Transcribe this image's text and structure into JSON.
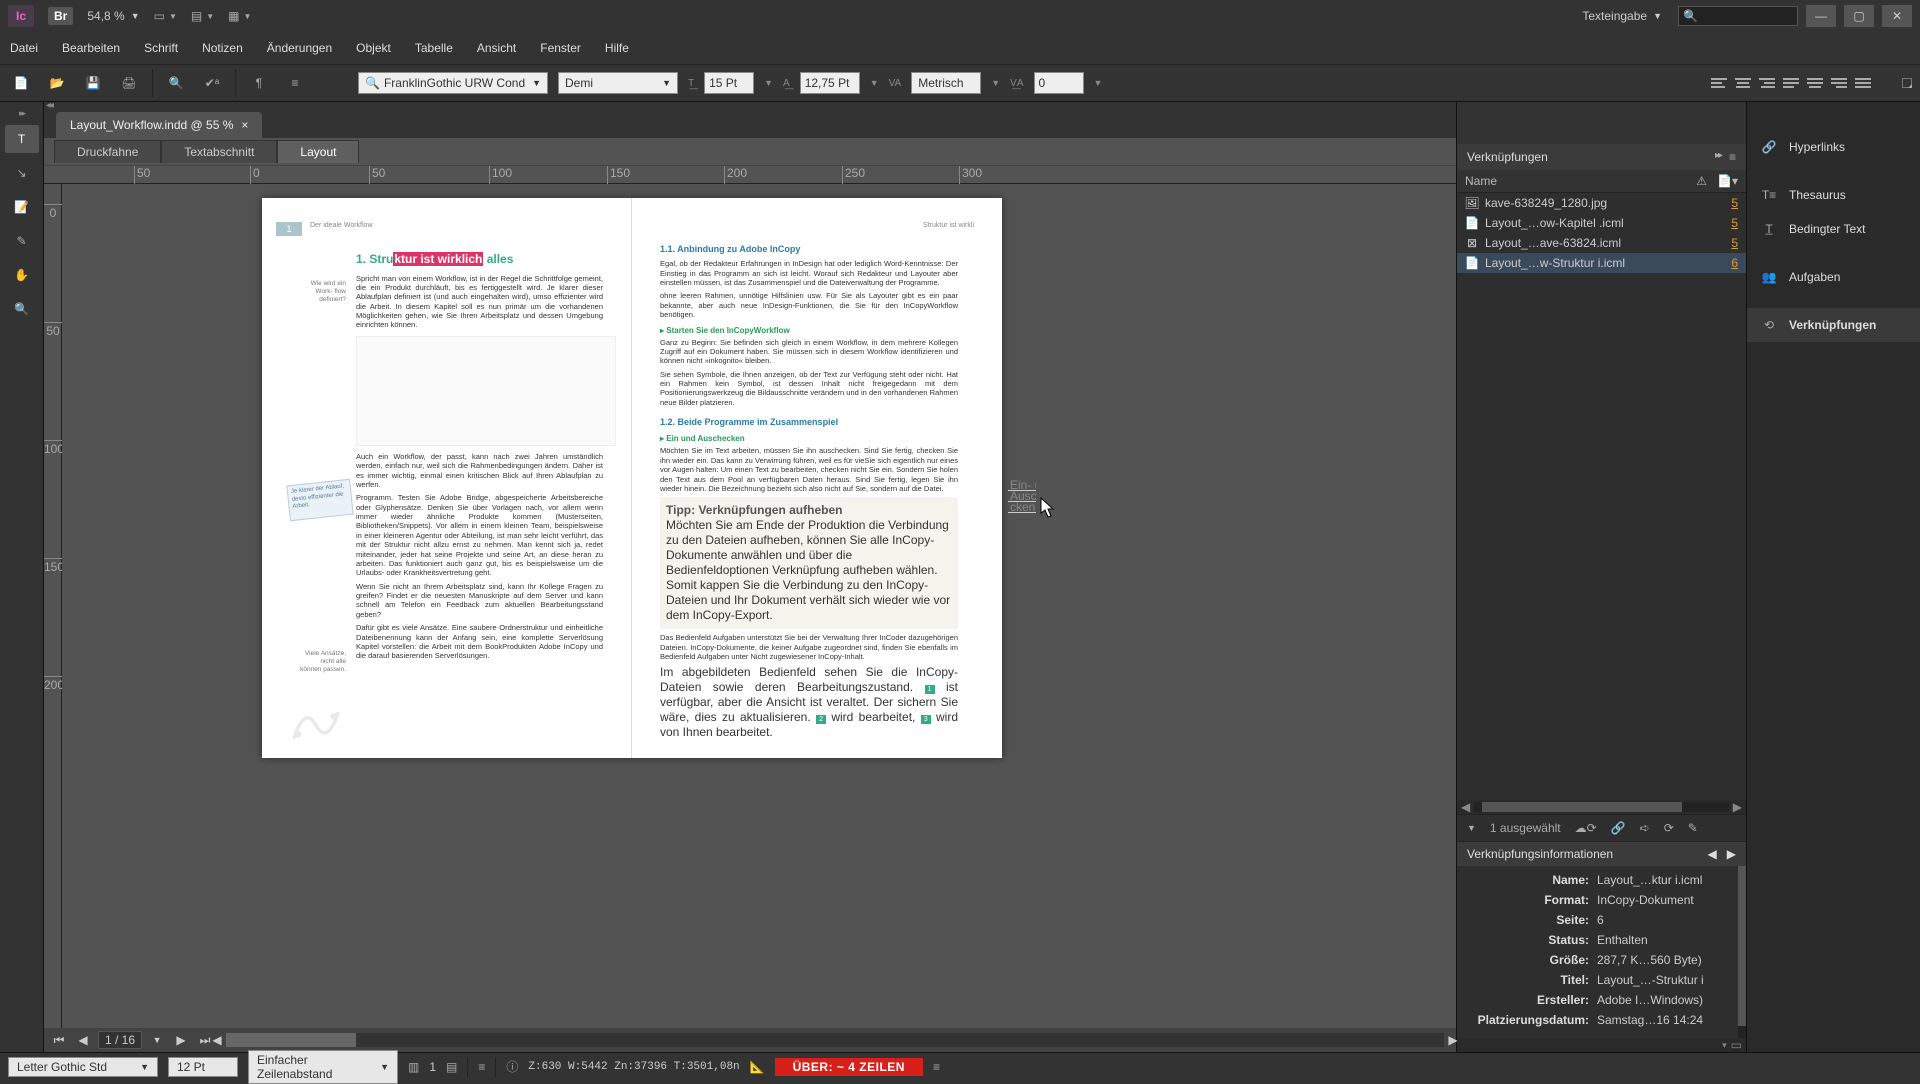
{
  "titlebar": {
    "ic": "Ic",
    "br": "Br",
    "zoom": "54,8 %",
    "workspace": "Texteingabe"
  },
  "menu": [
    "Datei",
    "Bearbeiten",
    "Schrift",
    "Notizen",
    "Änderungen",
    "Objekt",
    "Tabelle",
    "Ansicht",
    "Fenster",
    "Hilfe"
  ],
  "toolbar": {
    "font": "FranklinGothic URW Cond",
    "weight": "Demi",
    "size": "15 Pt",
    "leading": "12,75 Pt",
    "optical": "Metrisch",
    "tracking": "0"
  },
  "doc_tab": "Layout_Workflow.indd @ 55 %",
  "view_tabs": [
    "Druckfahne",
    "Textabschnitt",
    "Layout"
  ],
  "ruler_h": [
    "50",
    "0",
    "50",
    "100",
    "150",
    "200",
    "250",
    "300"
  ],
  "ruler_v": [
    "0",
    "50",
    "100",
    "150",
    "200"
  ],
  "page": {
    "num": "1",
    "run_left": "Der ideale Workflow",
    "run_right": "Struktur ist wirkli",
    "h1_pre": "1.   Stru",
    "h1_hl": "ktur ist wirklich",
    "h1_post": " alles",
    "mnote1": "Wie wird ein Work-\nflow definiert?",
    "p1": "Spricht man von einem Workflow, ist in der Regel die Schrittfolge gemeint, die ein Produkt durchläuft, bis es fertiggestellt wird. Je klarer dieser Ablaufplan definiert ist (und auch eingehalten wird), umso effizienter wird die Arbeit. In diesem Kapitel soll es nun primär um die vorhandenen Möglichkeiten gehen, wie Sie Ihren Arbeitsplatz und dessen Umgebung einrichten können.",
    "p2": "Auch ein Workflow, der passt, kann nach zwei Jahren umständlich werden, einfach nur, weil sich die Rahmenbedingungen ändern. Daher ist es immer wichtig, einmal einen kritischen Blick auf Ihren Ablaufplan zu werfen.",
    "p3": "Programm. Testen Sie Adobe Bridge, abgespeicherte Arbeitsbereiche oder Glyphensätze. Denken Sie über Vorlagen nach, vor allem wenn immer wieder ähnliche Produkte kommen (Musterseiten, Bibliotheken/Snippets). Vor allem in einem kleinen Team, beispielsweise in einer kleineren Agentur oder Abteilung, ist man sehr leicht verführt, das mit der Struktur nicht allzu ernst zu nehmen. Man kennt sich ja, redet miteinander, jeder hat seine Projekte und seine Art, an diese heran zu arbeiten. Das funktioniert auch ganz gut, bis es beispielsweise um die Urlaubs- oder Krankheitsvertretung geht.",
    "p4": "Wenn Sie nicht an Ihrem Arbeitsplatz sind, kann Ihr Kollege Fragen zu greifen? Findet er die neuesten Manuskripte auf dem Server und kann schnell am Telefon ein Feedback zum aktuellen Bearbeitungsstand geben?",
    "mnote2": "Viele Ansätze,\nnicht alle können\npassen.",
    "p5": "Dafür gibt es viele Ansätze. Eine saubere Ordnerstruktur und einheitliche Dateibenennung kann der Anfang sein, eine komplette Serverlösung Kapitel vorstellen: die Arbeit mit dem BookProdukten Adobe InCopy und die darauf basierenden Serverlösungen.",
    "sticky": "Je klarer der Ablauf,\ndesto effizienter die\nArbeit.",
    "h2a": "1.1.   Anbindung zu Adobe InCopy",
    "rp1": "Egal, ob der Redakteur Erfahrungen in InDesign hat oder lediglich Word-Kenntnisse: Der Einstieg in das Programm an sich ist leicht. Worauf sich Redakteur und Layouter aber einstellen müssen, ist das Zusammenspiel und die Dateiverwaltung der Programme.",
    "rp2": "ohne leeren Rahmen, unnötige Hilfslinien usw. Für Sie als Layouter gibt es ein paar bekannte, aber auch neue InDesign-Funktionen, die Sie für den InCopyWorkflow benötigen.",
    "h3a": "▸  Starten Sie den InCopyWorkflow",
    "rp3": "Ganz zu Beginn: Sie befinden sich gleich in einem Workflow, in dem mehrere Kollegen Zugriff auf ein Dokument haben. Sie müssen sich in diesem Workflow identifizieren und können nicht »inkognito« bleiben.",
    "rp4": "Sie sehen Symbole, die Ihnen anzeigen, ob der Text zur Verfügung steht oder nicht. Hat ein Rahmen kein Symbol, ist dessen Inhalt nicht freigegedann mit dem Positionierungswerkzeug die Bildausschnitte verändern und in den vorhandenen Rahmen neue Bilder platzieren.",
    "h2b": "1.2.   Beide Programme im Zusammenspiel",
    "h3b": "▸  Ein und Auschecken",
    "rp5": "Möchten Sie im Text arbeiten, müssen Sie ihn auschecken. Sind Sie fertig, checken Sie ihn wieder ein. Das kann zu Verwirrung führen, weil es für vieSie sich eigentlich nur eines vor Augen halten: Um einen Text zu bearbeiten, checken nicht Sie ein. Sondern Sie holen den Text aus dem Pool an verfügbaren Daten heraus. Sind Sie fertig, legen Sie ihn wieder hinein. Die Bezeichnung bezieht sich also nicht auf Sie, sondern auf die Datei.",
    "tip_t": "Tipp: Verknüpfungen aufheben",
    "tip_b": "Möchten Sie am Ende der Produktion die Verbindung zu den Dateien aufheben, können Sie alle InCopy-Dokumente anwählen und über die Bedienfeldoptionen Verknüpfung aufheben wählen. Somit kappen Sie die Verbindung zu den InCopy-Dateien und Ihr Dokument verhält sich wieder wie vor dem InCopy-Export.",
    "rp6a": "Das Bedienfeld Aufgaben unterstützt Sie bei der Verwaltung Ihrer InCoder dazugehörigen Dateien. InCopy-Dokumente, die keiner Aufgabe zugeordnet sind, finden Sie ebenfalls im Bedienfeld Aufgaben unter Nicht zugewiesener InCopy-Inhalt.",
    "rp6b": "Im abgebildeten Bedienfeld sehen Sie die InCopy-Dateien sowie deren Bearbeitungszustand. ",
    "rp6c": " ist verfügbar, aber die Ansicht ist veraltet. Der sichern Sie wäre, dies zu aktualisieren. ",
    "rp6d": " wird bearbeitet, ",
    "rp6e": " wird von Ihnen bearbeitet.",
    "ov": [
      "Ein- und",
      "Ausche",
      "cken bezi",
      "…",
      "…"
    ]
  },
  "page_nav": {
    "current": "1 / 16"
  },
  "links_panel": {
    "title": "Verknüpfungen",
    "col_name": "Name",
    "rows": [
      {
        "name": "kave-638249_1280.jpg",
        "page": "5",
        "sel": false,
        "type": "img"
      },
      {
        "name": "Layout_…ow-Kapitel .icml",
        "page": "5",
        "sel": false,
        "type": "icml"
      },
      {
        "name": "Layout_…ave-63824.icml",
        "page": "5",
        "sel": false,
        "type": "icmlx"
      },
      {
        "name": "Layout_…w-Struktur i.icml",
        "page": "6",
        "sel": true,
        "type": "icml"
      }
    ],
    "selected": "1 ausgewählt",
    "info_title": "Verknüpfungsinformationen",
    "info": [
      {
        "k": "Name:",
        "v": "Layout_…ktur i.icml"
      },
      {
        "k": "Format:",
        "v": "InCopy-Dokument"
      },
      {
        "k": "Seite:",
        "v": "6"
      },
      {
        "k": "Status:",
        "v": "Enthalten"
      },
      {
        "k": "Größe:",
        "v": "287,7 K…560 Byte)"
      },
      {
        "k": "Titel:",
        "v": "Layout_…-Struktur i"
      },
      {
        "k": "Ersteller:",
        "v": "Adobe I…Windows)"
      },
      {
        "k": "Platzierungsdatum:",
        "v": "Samstag…16 14:24"
      }
    ]
  },
  "side_tabs": [
    "Hyperlinks",
    "Thesaurus",
    "Bedingter Text",
    "Aufgaben",
    "Verknüpfungen"
  ],
  "status": {
    "font": "Letter Gothic Std",
    "size": "12 Pt",
    "leading": "Einfacher Zeilenabstand",
    "col": "1",
    "metrics": "Z:630   W:5442   Zn:37396   T:3501,08n",
    "over": "ÜBER:  ~ 4 ZEILEN"
  }
}
